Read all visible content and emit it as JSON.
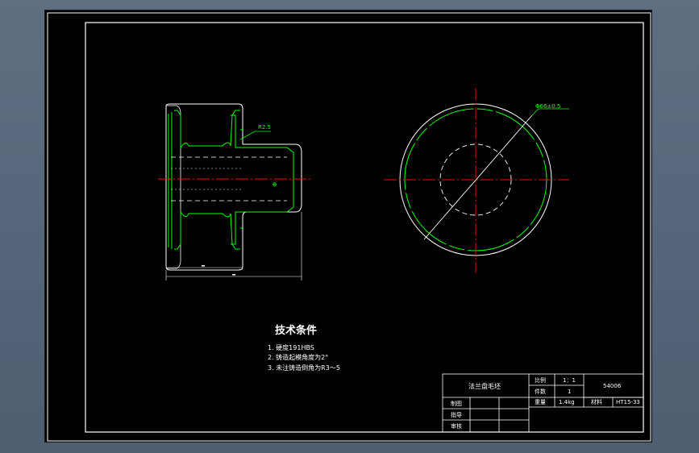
{
  "technical_conditions": {
    "title": "技术条件",
    "items": [
      "1.   硬度191HBS",
      "2.      铸造起模角度为2°",
      "3.  未注铸造倒角为R3～5"
    ]
  },
  "dimensions": {
    "chamfer": "R2.5",
    "diameter": "Φ66±0.5"
  },
  "title_block": {
    "part_name": "法兰盘毛坯",
    "scale_label": "比例",
    "scale_value": "1：1",
    "qty_label": "件数",
    "qty_value": "1",
    "weight_label": "重量",
    "weight_value": "1.4kg",
    "material_label": "材料",
    "material_value": "HT15-33",
    "drawing_no": "54006",
    "design_label": "制图",
    "guide_label": "指导",
    "review_label": "审核"
  },
  "colors": {
    "drawing_bg": "#000000",
    "viewport_bg": "#5b6a7c",
    "outline": "#ffffff",
    "centerline": "#ff0000",
    "feature": "#00ff00"
  }
}
